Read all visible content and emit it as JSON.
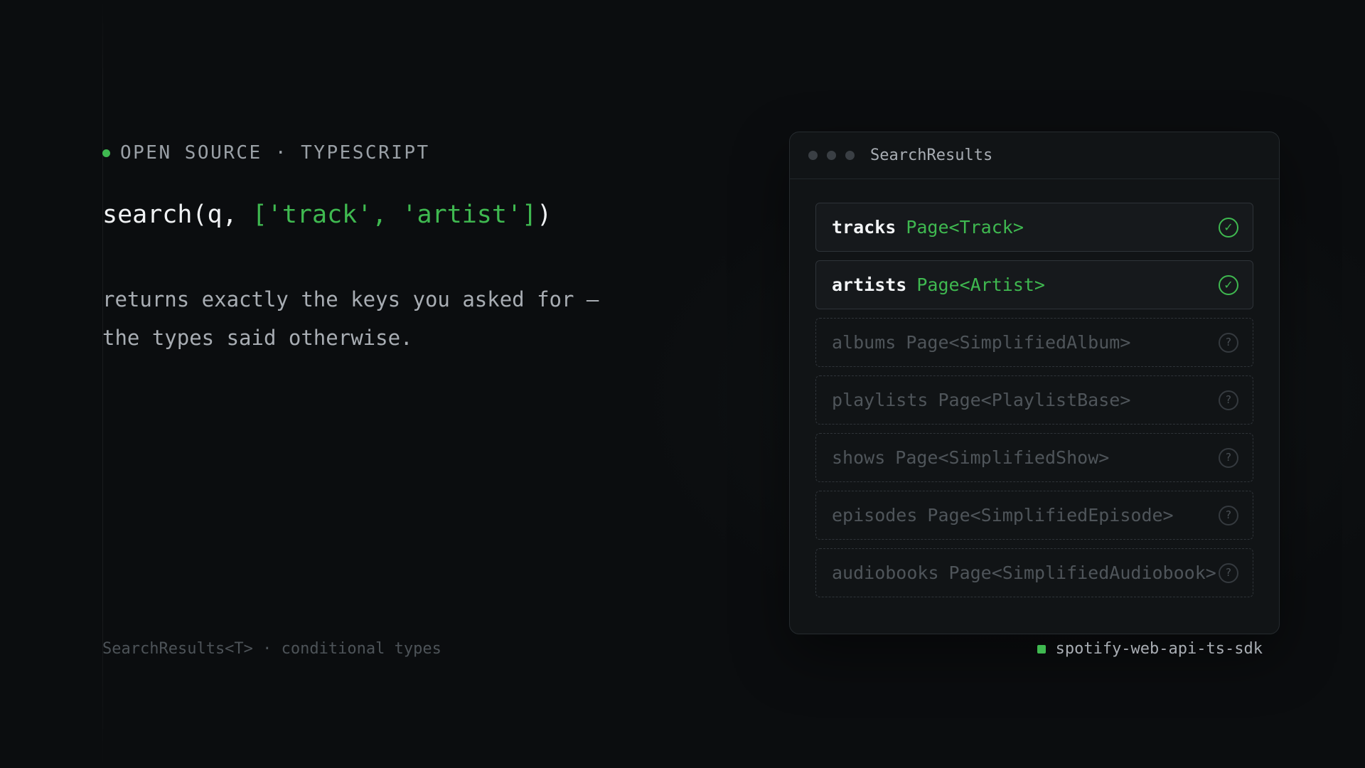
{
  "eyebrow": {
    "text": "OPEN SOURCE · TYPESCRIPT"
  },
  "headline": {
    "call_prefix": "search(q, ",
    "call_args": "['track', 'artist']",
    "call_suffix": ")"
  },
  "description": {
    "line1": "returns exactly the keys you asked for —",
    "line2": "the types said otherwise."
  },
  "footnote": "SearchResults<T> · conditional types",
  "panel": {
    "title": "SearchResults",
    "rows": [
      {
        "key": "tracks",
        "type": "Page<Track>",
        "status": "✓"
      },
      {
        "key": "artists",
        "type": "Page<Artist>",
        "status": "✓"
      },
      {
        "key": "albums",
        "type": "Page<SimplifiedAlbum>",
        "status": "?"
      },
      {
        "key": "playlists",
        "type": "Page<PlaylistBase>",
        "status": "?"
      },
      {
        "key": "shows",
        "type": "Page<SimplifiedShow>",
        "status": "?"
      },
      {
        "key": "episodes",
        "type": "Page<SimplifiedEpisode>",
        "status": "?"
      },
      {
        "key": "audiobooks",
        "type": "Page<SimplifiedAudiobook>",
        "status": "?"
      }
    ]
  },
  "repo": {
    "name": "spotify-web-api-ts-sdk"
  },
  "colors": {
    "accent": "#3fb950",
    "background": "#0b0d0f",
    "panel": "#111416",
    "muted": "#4f555a"
  }
}
